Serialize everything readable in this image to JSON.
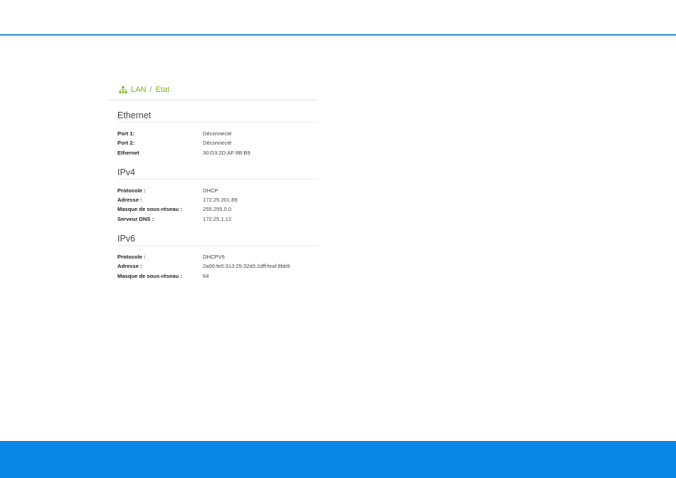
{
  "breadcrumb": {
    "icon": "network-icon",
    "item1": "LAN",
    "separator": "/",
    "item2": "Etat",
    "color": "#7ab317"
  },
  "sections": {
    "ethernet": {
      "title": "Ethernet",
      "rows": [
        {
          "label": "Port 1:",
          "value": "Déconnecté"
        },
        {
          "label": "Port 2:",
          "value": "Déconnecté"
        },
        {
          "label": "Ethernet",
          "value": "30:D3:2D:AF:8B:B9"
        }
      ]
    },
    "ipv4": {
      "title": "IPv4",
      "rows": [
        {
          "label": "Protocole :",
          "value": "DHCP"
        },
        {
          "label": "Adresse :",
          "value": "172.25.201.89"
        },
        {
          "label": "Masque de sous-réseau :",
          "value": "255.255.0.0"
        },
        {
          "label": "Serveur DNS :",
          "value": "172.25.1.12"
        }
      ]
    },
    "ipv6": {
      "title": "IPv6",
      "rows": [
        {
          "label": "Protocole :",
          "value": "DHCPV6"
        },
        {
          "label": "Adresse :",
          "value": "2a00:fe0:313:25:32d3:2dff:feaf:8bb9"
        },
        {
          "label": "Masque de sous-réseau :",
          "value": "64"
        }
      ]
    }
  },
  "colors": {
    "top_rule": "#1b8fdf",
    "bottom_bar": "#0a86e6"
  }
}
